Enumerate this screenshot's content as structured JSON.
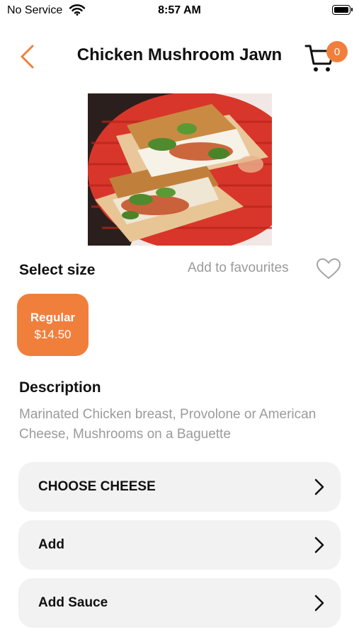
{
  "status_bar": {
    "carrier": "No Service",
    "time": "8:57 AM"
  },
  "header": {
    "title": "Chicken Mushroom Jawn",
    "cart_count": "0"
  },
  "product": {
    "image_alt": "Chicken Mushroom Jawn sandwich"
  },
  "size": {
    "label": "Select size",
    "favourites_label": "Add to favourites",
    "options": [
      {
        "name": "Regular",
        "price": "$14.50",
        "selected": true
      }
    ]
  },
  "description": {
    "title": "Description",
    "text": "Marinated Chicken breast, Provolone or American Cheese, Mushrooms on a Baguette"
  },
  "options": [
    {
      "label": "CHOOSE CHEESE"
    },
    {
      "label": "Add"
    },
    {
      "label": "Add Sauce"
    }
  ],
  "colors": {
    "accent": "#f07f3c",
    "muted_text": "#9b9b9b",
    "row_bg": "#f2f2f2"
  },
  "icons": [
    "wifi-icon",
    "battery-icon",
    "chevron-left-icon",
    "cart-icon",
    "heart-icon",
    "chevron-right-icon"
  ]
}
